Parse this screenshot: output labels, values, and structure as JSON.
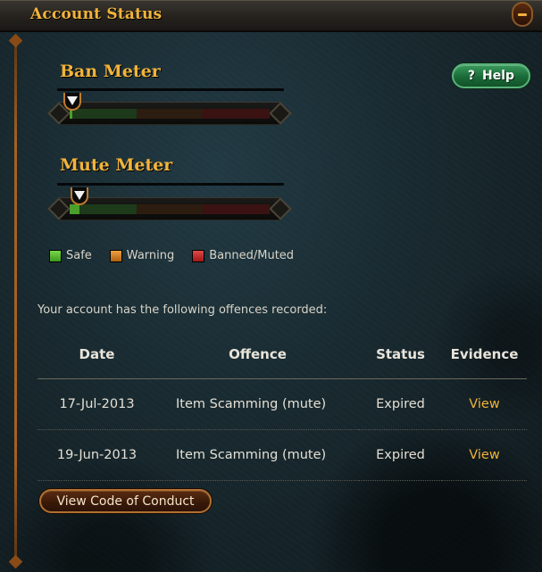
{
  "window": {
    "title": "Account Status"
  },
  "ban_meter": {
    "title": "Ban Meter",
    "level_percent": 1
  },
  "mute_meter": {
    "title": "Mute Meter",
    "level_percent": 5
  },
  "help_button": {
    "icon": "question-mark",
    "label": "Help"
  },
  "legend": [
    {
      "label": "Safe",
      "color": "#5cc034"
    },
    {
      "label": "Warning",
      "color": "#d88a2a"
    },
    {
      "label": "Banned/Muted",
      "color": "#c83030"
    }
  ],
  "offences": {
    "intro": "Your account has the following offences recorded:",
    "columns": [
      "Date",
      "Offence",
      "Status",
      "Evidence"
    ],
    "rows": [
      {
        "date": "17-Jul-2013",
        "offence": "Item Scamming (mute)",
        "status": "Expired",
        "evidence": "View"
      },
      {
        "date": "19-Jun-2013",
        "offence": "Item Scamming (mute)",
        "status": "Expired",
        "evidence": "View"
      }
    ]
  },
  "code_of_conduct_button": {
    "label": "View Code of Conduct"
  },
  "colors": {
    "accent_gold": "#f2b43a",
    "link": "#f0b43a",
    "help_green": "#1a6a38"
  }
}
